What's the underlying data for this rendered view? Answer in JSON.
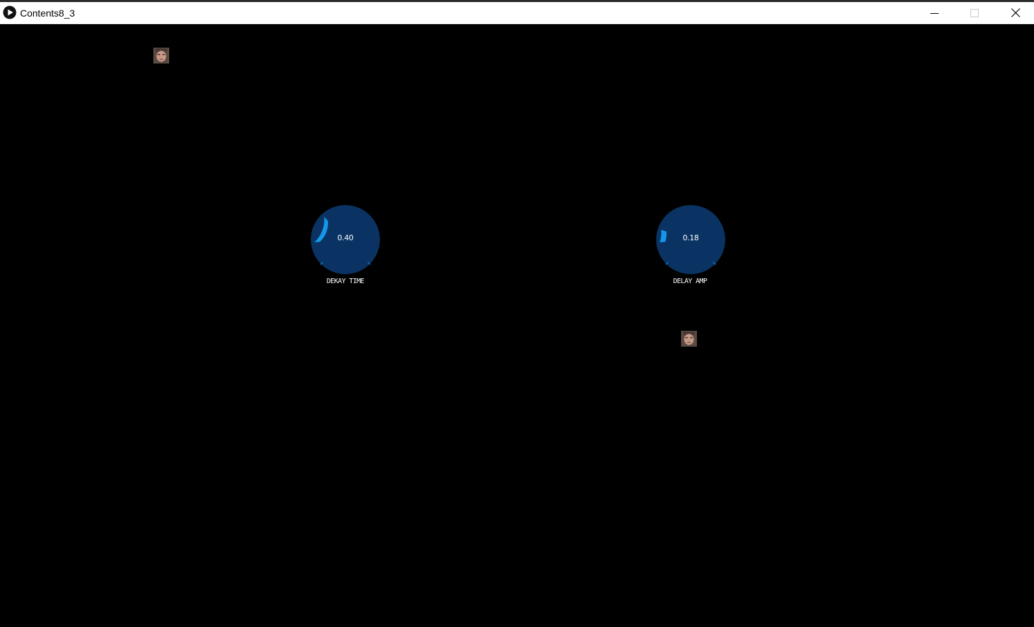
{
  "window": {
    "title": "Contents8_3",
    "controls": {
      "minimize_icon": "minimize-icon",
      "maximize_icon": "maximize-icon",
      "close_icon": "close-icon"
    }
  },
  "colors": {
    "background": "#000000",
    "knob_body": "#0a3363",
    "knob_arc": "#1596e8",
    "knob_tick": "#0f6fb5",
    "text": "#ffffff"
  },
  "knobs": [
    {
      "value_text": "0.40",
      "label": "DEKAY TIME",
      "value": 0.4
    },
    {
      "value_text": "0.18",
      "label": "DELAY AMP",
      "value": 0.18
    }
  ],
  "sprites": [
    {
      "icon": "face-sprite-icon"
    },
    {
      "icon": "face-sprite-icon"
    }
  ]
}
